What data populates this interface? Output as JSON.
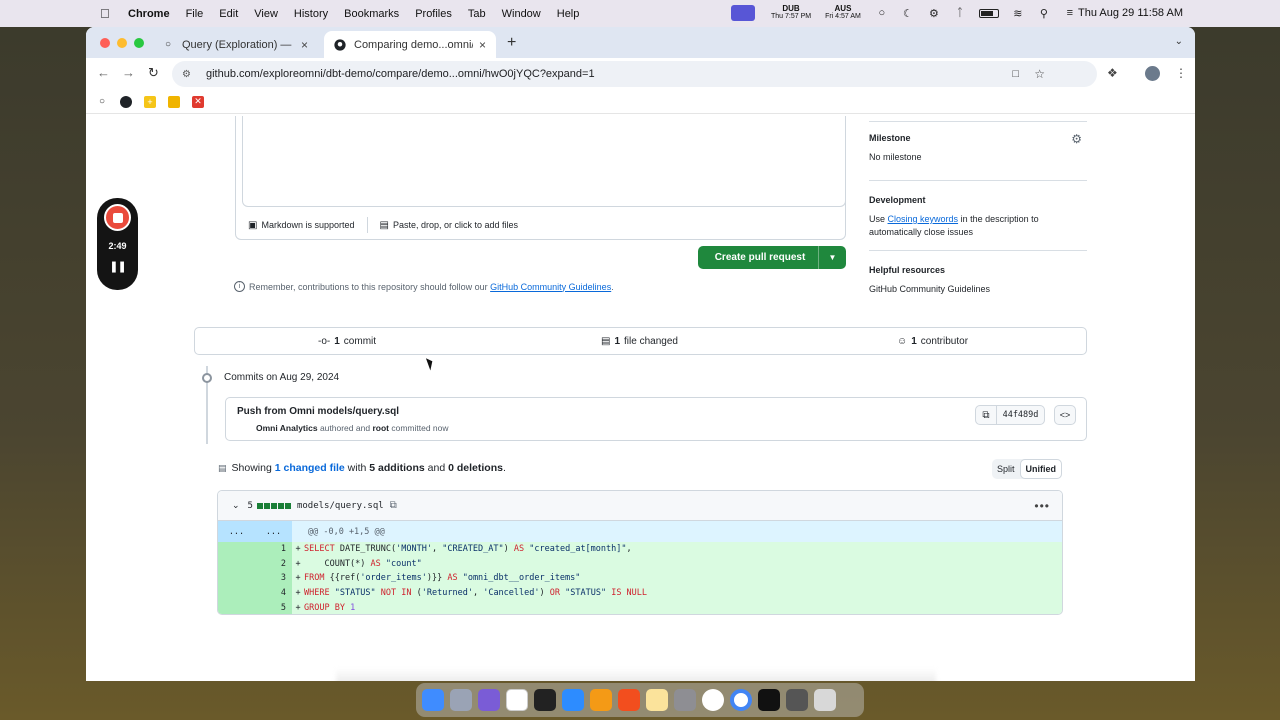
{
  "menubar": {
    "app_name": "Chrome",
    "items": [
      "File",
      "Edit",
      "View",
      "History",
      "Bookmarks",
      "Profiles",
      "Tab",
      "Window",
      "Help"
    ],
    "tz1_city": "DUB",
    "tz1_time": "Thu 7:57 PM",
    "tz2_city": "AUS",
    "tz2_time": "Fri 4:57 AM",
    "clock": "Thu Aug 29  11:58 AM"
  },
  "browser": {
    "tab_inactive_title": "Query (Exploration) — O",
    "tab_active_title": "Comparing demo...omni/hwO",
    "url": "github.com/exploreomni/dbt-demo/compare/demo...omni/hwO0jYQC?expand=1",
    "tab_close": "×",
    "new_tab": "+"
  },
  "comment": {
    "markdown_label": "Markdown is supported",
    "attach_label": "Paste, drop, or click to add files"
  },
  "create_pr_label": "Create pull request",
  "remember": {
    "text": "Remember, contributions to this repository should follow our",
    "link": "GitHub Community Guidelines",
    "period": "."
  },
  "sidebar": {
    "milestone_title": "Milestone",
    "milestone_value": "No milestone",
    "development_title": "Development",
    "development_prefix": "Use",
    "development_link": "Closing keywords",
    "development_suffix": "in the description to automatically close issues",
    "helpful_title": "Helpful resources",
    "helpful_link": "GitHub Community Guidelines"
  },
  "summary": {
    "commits_count": "1",
    "commits_label": "commit",
    "files_count": "1",
    "files_label": "file changed",
    "contributors_count": "1",
    "contributors_label": "contributor"
  },
  "commits": {
    "date_label": "Commits on Aug 29, 2024",
    "message": "Push from Omni models/query.sql",
    "author": "Omni Analytics",
    "authored": "authored and",
    "committer": "root",
    "committed": "committed now",
    "sha": "44f489d"
  },
  "showing": {
    "prefix": "Showing",
    "changed_files": "1 changed file",
    "with": "with",
    "additions": "5 additions",
    "and": "and",
    "deletions": "0 deletions",
    "period": ".",
    "split_label": "Split",
    "unified_label": "Unified"
  },
  "diff": {
    "file_count": "5",
    "filename": "models/query.sql",
    "hunk_left": "...",
    "hunk_right": "...",
    "hunk_header": "@@ -0,0 +1,5 @@",
    "lines": [
      {
        "num": "1",
        "code": "SELECT DATE_TRUNC('MONTH', \"CREATED_AT\") AS \"created_at[month]\","
      },
      {
        "num": "2",
        "code": "    COUNT(*) AS \"count\""
      },
      {
        "num": "3",
        "code": "FROM {{ref('order_items')}} AS \"omni_dbt__order_items\""
      },
      {
        "num": "4",
        "code": "WHERE \"STATUS\" NOT IN ('Returned', 'Cancelled') OR \"STATUS\" IS NULL"
      },
      {
        "num": "5",
        "code": "GROUP BY 1"
      }
    ]
  },
  "recorder": {
    "time": "2:49"
  }
}
